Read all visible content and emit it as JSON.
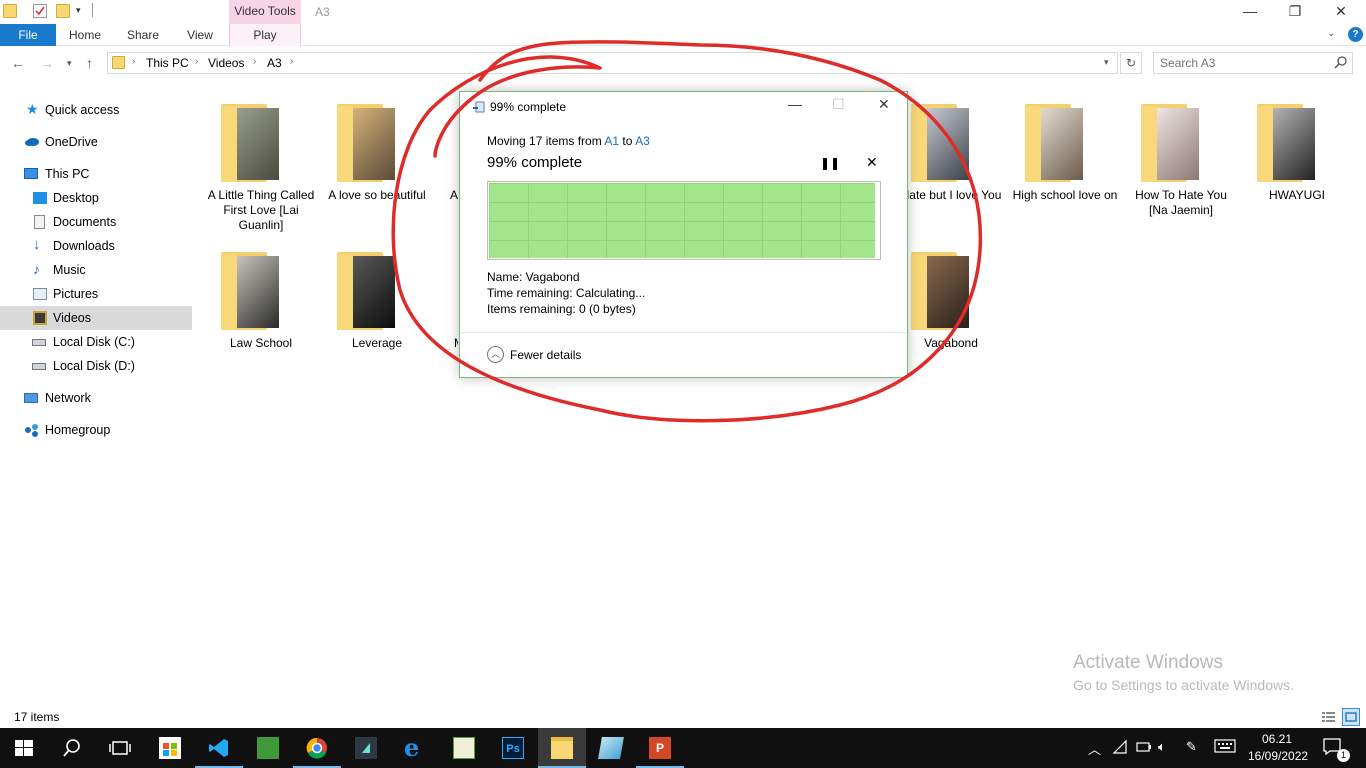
{
  "titlebar": {
    "context_tab": "Video Tools",
    "window_title": "A3",
    "minimize": "—",
    "restore": "❐",
    "close": "✕"
  },
  "ribbon": {
    "tabs": [
      "File",
      "Home",
      "Share",
      "View",
      "Play"
    ],
    "help": "?"
  },
  "address": {
    "crumbs": [
      "This PC",
      "Videos",
      "A3"
    ],
    "search_placeholder": "Search A3"
  },
  "sidebar": {
    "items": [
      {
        "label": "Quick access",
        "icon": "star-icon"
      },
      {
        "label": "OneDrive",
        "icon": "cloud-icon"
      },
      {
        "label": "This PC",
        "icon": "computer-icon"
      },
      {
        "label": "Desktop",
        "icon": "desktop-icon"
      },
      {
        "label": "Documents",
        "icon": "documents-icon"
      },
      {
        "label": "Downloads",
        "icon": "download-icon"
      },
      {
        "label": "Music",
        "icon": "music-icon"
      },
      {
        "label": "Pictures",
        "icon": "pictures-icon"
      },
      {
        "label": "Videos",
        "icon": "videos-icon"
      },
      {
        "label": "Local Disk (C:)",
        "icon": "drive-icon"
      },
      {
        "label": "Local Disk (D:)",
        "icon": "drive-icon"
      },
      {
        "label": "Network",
        "icon": "network-icon"
      },
      {
        "label": "Homegroup",
        "icon": "homegroup-icon"
      }
    ]
  },
  "folders": [
    {
      "name": "A Little Thing Called First Love [Lai Guanlin]"
    },
    {
      "name": "A love so beautiful"
    },
    {
      "name": "A t"
    },
    {
      "name": "Hate but I love You"
    },
    {
      "name": "High school love on"
    },
    {
      "name": "How To Hate You [Na Jaemin]"
    },
    {
      "name": "HWAYUGI"
    },
    {
      "name": "Law School"
    },
    {
      "name": "Leverage"
    },
    {
      "name": "M"
    },
    {
      "name": "Vagabond"
    }
  ],
  "dialog": {
    "title": "99% complete",
    "moving_prefix": "Moving 17 items from ",
    "source": "A1",
    "to_word": " to ",
    "destination": "A3",
    "percent_text": "99% complete",
    "progress": 0.99,
    "pause": "❚❚",
    "cancel": "✕",
    "name_line": "Name:  Vagabond",
    "time_line": "Time remaining:  Calculating...",
    "items_line": "Items remaining:  0 (0 bytes)",
    "fewer_details": "Fewer details"
  },
  "status": {
    "item_count": "17 items"
  },
  "watermark": {
    "line1": "Activate Windows",
    "line2": "Go to Settings to activate Windows."
  },
  "taskbar": {
    "time": "06.21",
    "date": "16/09/2022",
    "notifications": "1",
    "accent": "#76b9ed"
  }
}
